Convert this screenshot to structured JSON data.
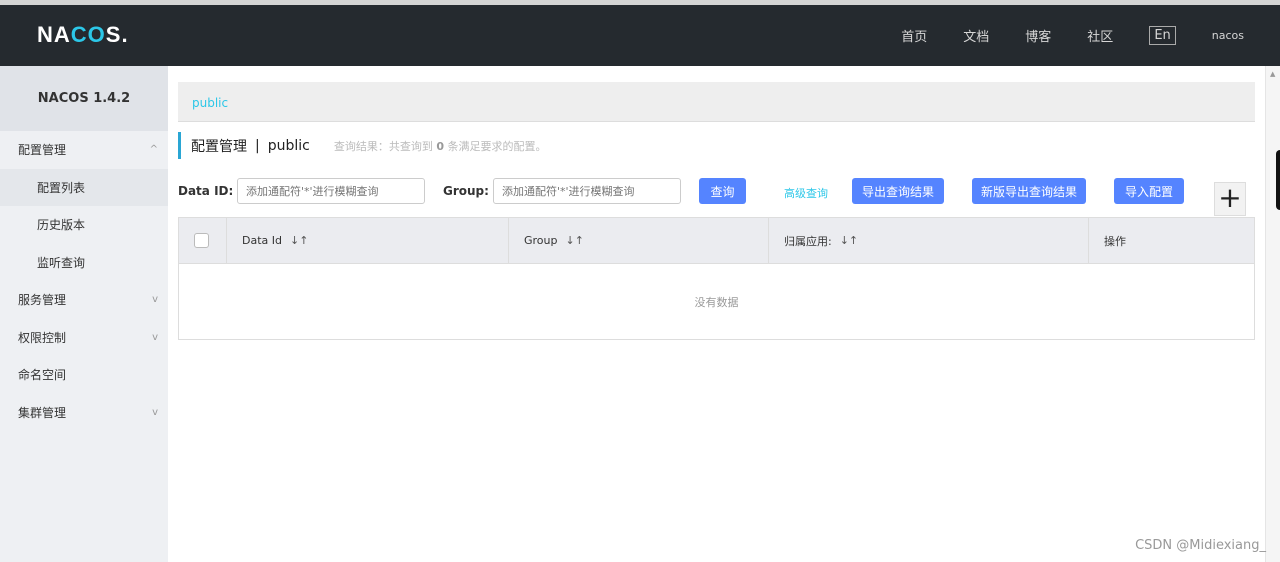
{
  "header": {
    "logo_pre": "NA",
    "logo_mid": "CO",
    "logo_post": "S.",
    "nav": [
      "首页",
      "文档",
      "博客",
      "社区"
    ],
    "lang": "En",
    "user": "nacos"
  },
  "sidebar": {
    "title": "NACOS 1.4.2",
    "items": [
      {
        "label": "配置管理",
        "chev": "^"
      },
      {
        "label": "配置列表"
      },
      {
        "label": "历史版本"
      },
      {
        "label": "监听查询"
      },
      {
        "label": "服务管理",
        "chev": "v"
      },
      {
        "label": "权限控制",
        "chev": "v"
      },
      {
        "label": "命名空间"
      },
      {
        "label": "集群管理",
        "chev": "v"
      }
    ]
  },
  "breadcrumb": "public",
  "title": {
    "main": "配置管理",
    "sep": "|",
    "ns": "public",
    "result_pre": "查询结果：共查询到",
    "count": "0",
    "result_post": "条满足要求的配置。"
  },
  "filter": {
    "dataid_label": "Data ID:",
    "dataid_placeholder": "添加通配符'*'进行模糊查询",
    "group_label": "Group:",
    "group_placeholder": "添加通配符'*'进行模糊查询",
    "query": "查询",
    "advanced": "高级查询",
    "export": "导出查询结果",
    "export_new": "新版导出查询结果",
    "import": "导入配置",
    "add": "+"
  },
  "table": {
    "columns": [
      "Data Id",
      "Group",
      "归属应用:",
      "操作"
    ],
    "sort_icon": "↓↑",
    "empty": "没有数据"
  },
  "watermark": "CSDN @Midiexiang_"
}
